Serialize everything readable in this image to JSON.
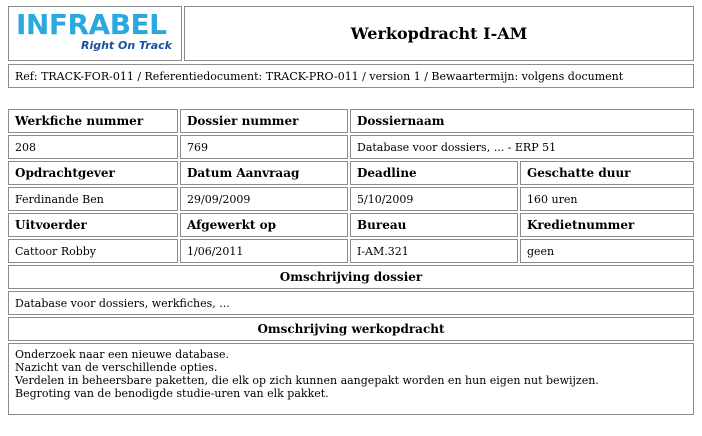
{
  "header": {
    "logo_text": "INFRABEL",
    "logo_tagline": "Right On Track",
    "title": "Werkopdracht I-AM"
  },
  "reference": "Ref: TRACK-FOR-011 / Referentiedocument: TRACK-PRO-011 / version 1 / Bewaartermijn: volgens document",
  "fields": {
    "werkfiche_nummer": {
      "label": "Werkfiche nummer",
      "value": "208"
    },
    "dossier_nummer": {
      "label": "Dossier nummer",
      "value": "769"
    },
    "dossiernaam": {
      "label": "Dossiernaam",
      "value": "Database voor dossiers, ...  - ERP 51"
    },
    "opdrachtgever": {
      "label": "Opdrachtgever",
      "value": "Ferdinande Ben"
    },
    "datum_aanvraag": {
      "label": "Datum Aanvraag",
      "value": "29/09/2009"
    },
    "deadline": {
      "label": "Deadline",
      "value": "5/10/2009"
    },
    "geschatte_duur": {
      "label": "Geschatte duur",
      "value": "160 uren"
    },
    "uitvoerder": {
      "label": "Uitvoerder",
      "value": "Cattoor Robby"
    },
    "afgewerkt_op": {
      "label": "Afgewerkt op",
      "value": "1/06/2011"
    },
    "bureau": {
      "label": "Bureau",
      "value": "I-AM.321"
    },
    "kredietnummer": {
      "label": "Kredietnummer",
      "value": "geen"
    }
  },
  "omschrijving_dossier": {
    "label": "Omschrijving dossier",
    "value": "Database voor dossiers, werkfiches, ..."
  },
  "omschrijving_werkopdracht": {
    "label": "Omschrijving werkopdracht",
    "lines": [
      "Onderzoek naar een nieuwe database.",
      "Nazicht van de verschillende opties.",
      "Verdelen in beheersbare paketten, die elk op zich kunnen aangepakt worden en hun eigen nut bewijzen.",
      "Begroting van de benodigde studie-uren van elk pakket."
    ]
  },
  "colors": {
    "logo_blue": "#2aa8e0",
    "tagline_blue": "#1a4f9c",
    "border": "#8c8c8c"
  }
}
